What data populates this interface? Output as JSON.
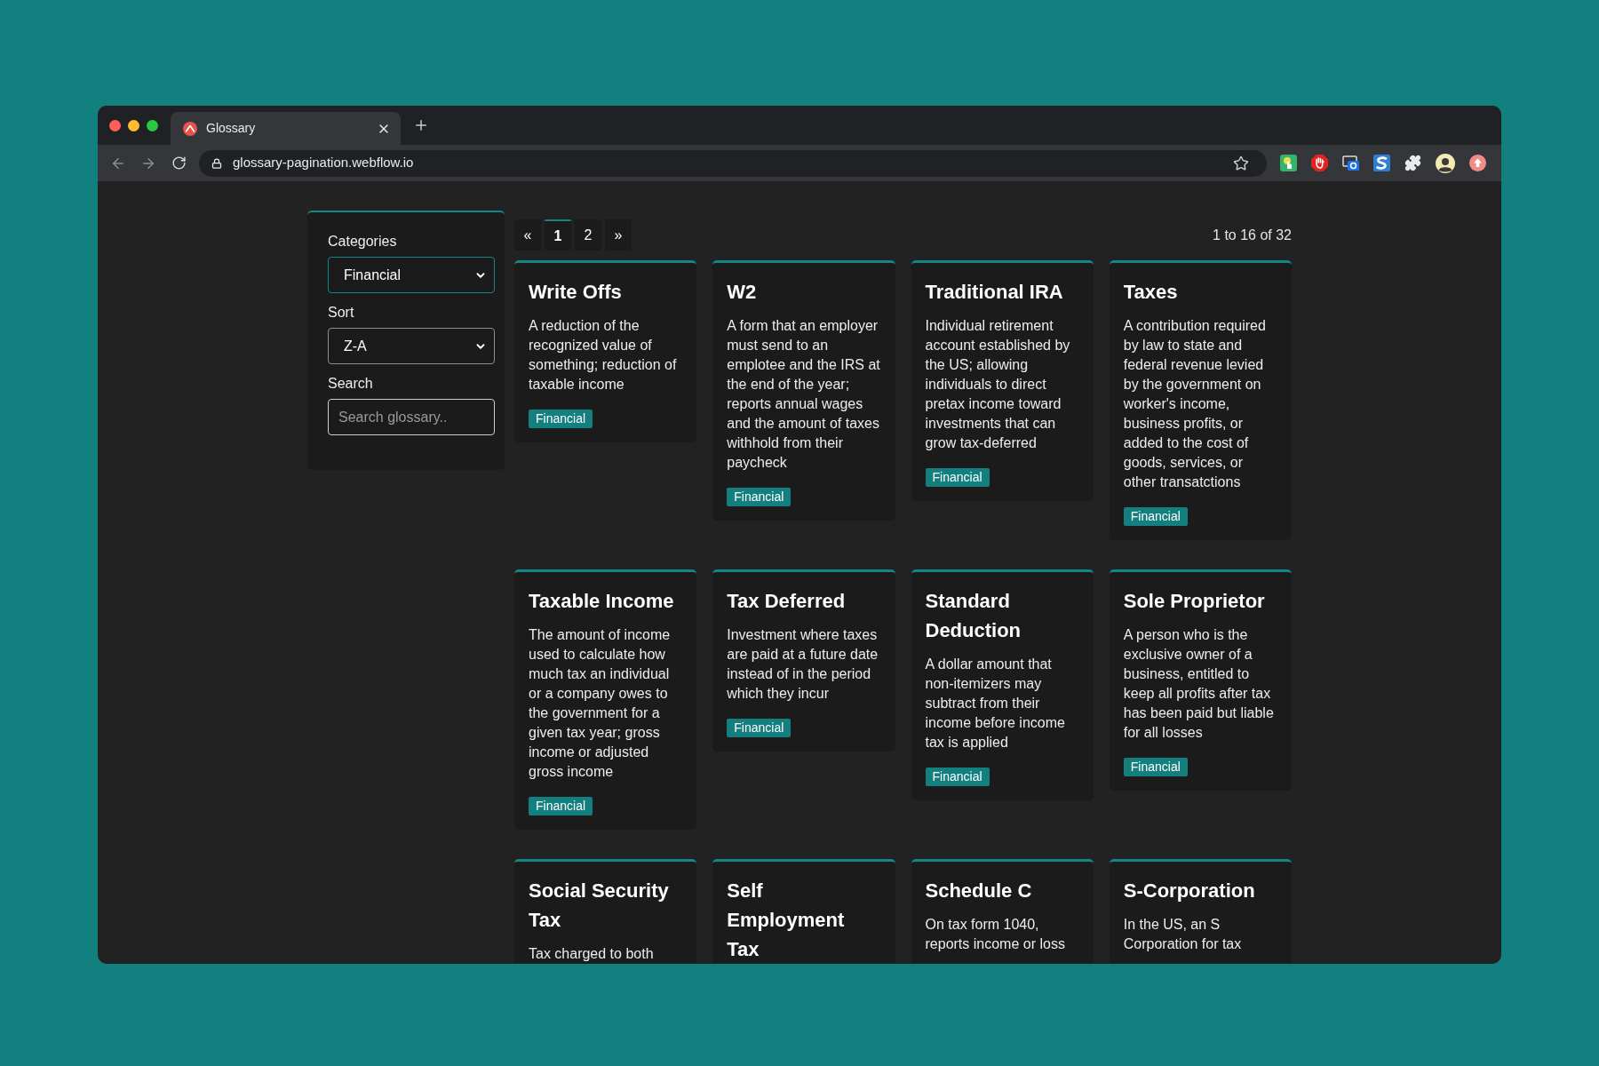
{
  "browser": {
    "tab": {
      "title": "Glossary"
    },
    "address_bar": {
      "url": "glossary-pagination.webflow.io"
    }
  },
  "filters": {
    "categories": {
      "label": "Categories",
      "value": "Financial",
      "focused": true
    },
    "sort": {
      "label": "Sort",
      "value": "Z-A",
      "focused": false
    },
    "search": {
      "label": "Search",
      "placeholder": "Search glossary.."
    }
  },
  "pagination": {
    "items": [
      {
        "label": "«",
        "selected": false
      },
      {
        "label": "1",
        "selected": true
      },
      {
        "label": "2",
        "selected": false
      },
      {
        "label": "»",
        "selected": false
      }
    ],
    "result_count": "1 to 16 of 32"
  },
  "cards": [
    {
      "title": "Write Offs",
      "description": "A reduction of the recognized value of something; reduction of taxable income",
      "tag": "Financial"
    },
    {
      "title": "W2",
      "description": "A form that an employer must send to an emplotee and the IRS at the end of the year; reports annual wages and the amount of taxes withhold from their paycheck",
      "tag": "Financial"
    },
    {
      "title": "Traditional IRA",
      "description": "Individual retirement account established by the US; allowing individuals to direct pretax income toward investments that can grow tax-deferred",
      "tag": "Financial"
    },
    {
      "title": "Taxes",
      "description": "A contribution required by law to state and federal revenue levied by the government on worker's income, business profits, or added to the cost of goods, services, or other transatctions",
      "tag": "Financial"
    },
    {
      "title": "Taxable Income",
      "description": "The amount of income used to calculate how much tax an individual or a company owes to the government for a given tax year; gross income or adjusted gross income",
      "tag": "Financial"
    },
    {
      "title": "Tax Deferred",
      "description": "Investment where taxes are paid at a future date instead of in the period which they incur",
      "tag": "Financial"
    },
    {
      "title": "Standard Deduction",
      "description": "A dollar amount that non-itemizers may subtract from their income before income tax is applied",
      "tag": "Financial"
    },
    {
      "title": "Sole Proprietor",
      "description": "A person who is the exclusive owner of a business, entitled to keep all profits after tax has been paid but liable for all losses",
      "tag": "Financial"
    },
    {
      "title": "Social Security Tax",
      "description": "Tax charged to both"
    },
    {
      "title": "Self Employment Tax"
    },
    {
      "title": "Schedule C",
      "description": "On tax form 1040, reports income or loss"
    },
    {
      "title": "S-Corporation",
      "description": "In the US, an S Corporation for tax"
    }
  ]
}
